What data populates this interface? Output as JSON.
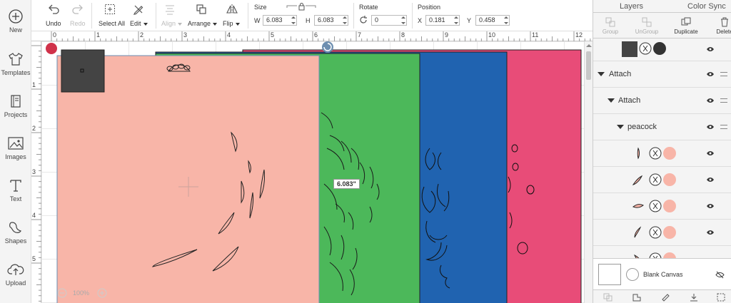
{
  "sidebar": {
    "items": [
      {
        "label": "New",
        "icon": "plus-circle-icon"
      },
      {
        "label": "Templates",
        "icon": "shirt-icon"
      },
      {
        "label": "Projects",
        "icon": "book-icon"
      },
      {
        "label": "Images",
        "icon": "image-icon"
      },
      {
        "label": "Text",
        "icon": "text-t-icon"
      },
      {
        "label": "Shapes",
        "icon": "shapes-icon"
      },
      {
        "label": "Upload",
        "icon": "cloud-upload-icon"
      }
    ]
  },
  "toolbar": {
    "undo": "Undo",
    "redo": "Redo",
    "select_all": "Select All",
    "edit": "Edit",
    "align": "Align",
    "arrange": "Arrange",
    "flip": "Flip",
    "size_label": "Size",
    "w_label": "W",
    "w_value": "6.083",
    "h_label": "H",
    "h_value": "6.083",
    "rotate_label": "Rotate",
    "rotate_value": "0",
    "position_label": "Position",
    "x_label": "X",
    "x_value": "0.181",
    "y_label": "Y",
    "y_value": "0.458"
  },
  "ruler": {
    "h_numbers": [
      "0",
      "1",
      "2",
      "3",
      "4",
      "5",
      "6",
      "7",
      "8",
      "9",
      "10",
      "11",
      "12"
    ],
    "v_numbers": [
      "1",
      "2",
      "3",
      "4",
      "5",
      "6"
    ]
  },
  "canvas": {
    "dimension_label": "6.083\"",
    "zoom": "100%",
    "colors": {
      "pink": "#f8b5a8",
      "green": "#4cb85a",
      "blue": "#2063b0",
      "magenta": "#e84c78",
      "dark": "#444444"
    }
  },
  "layers_panel": {
    "tabs": [
      "Layers",
      "Color Sync"
    ],
    "buttons": [
      {
        "label": "Group",
        "icon": "group-icon"
      },
      {
        "label": "UnGroup",
        "icon": "ungroup-icon"
      },
      {
        "label": "Duplicate",
        "icon": "duplicate-icon"
      },
      {
        "label": "Delete",
        "icon": "trash-icon"
      }
    ],
    "rows": [
      {
        "label": "Attach"
      },
      {
        "label": "Attach"
      },
      {
        "label": "peacock"
      }
    ],
    "blank_canvas": "Blank Canvas"
  }
}
